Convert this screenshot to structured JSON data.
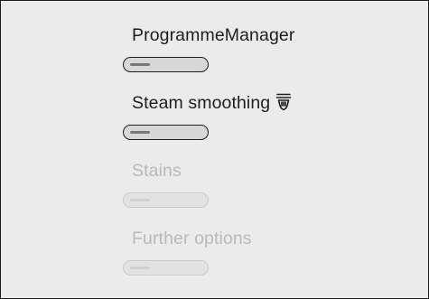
{
  "menu": {
    "items": [
      {
        "label": "ProgrammeManager",
        "icon": null,
        "enabled": true
      },
      {
        "label": "Steam smoothing",
        "icon": "steam-iron-icon",
        "enabled": true
      },
      {
        "label": "Stains",
        "icon": null,
        "enabled": false
      },
      {
        "label": "Further options",
        "icon": null,
        "enabled": false
      }
    ]
  },
  "colors": {
    "background": "#ebebeb",
    "text_active": "#1e1e1e",
    "text_disabled": "#b9b9b9"
  }
}
